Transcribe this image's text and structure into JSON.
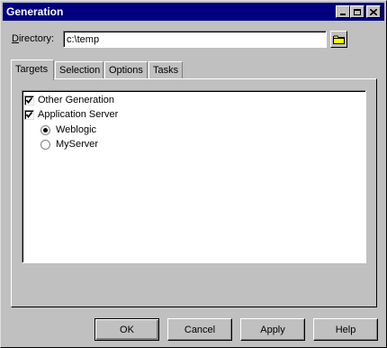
{
  "window": {
    "title": "Generation"
  },
  "directory": {
    "label_prefix": "D",
    "label_rest": "irectory:",
    "value": "c:\\temp"
  },
  "tabs": [
    {
      "label": "Targets",
      "active": true
    },
    {
      "label": "Selection",
      "active": false
    },
    {
      "label": "Options",
      "active": false
    },
    {
      "label": "Tasks",
      "active": false
    }
  ],
  "targets": {
    "items": [
      {
        "label": "Other Generation",
        "type": "checkbox",
        "checked": true
      },
      {
        "label": "Application Server",
        "type": "checkbox",
        "checked": true
      },
      {
        "label": "Weblogic",
        "type": "radio",
        "selected": true
      },
      {
        "label": "MyServer",
        "type": "radio",
        "selected": false
      }
    ]
  },
  "buttons": {
    "ok": "OK",
    "cancel": "Cancel",
    "apply": "Apply",
    "help": "Help"
  },
  "icons": {
    "minimize": "minimize-icon",
    "maximize": "maximize-icon",
    "close": "close-icon",
    "folder": "folder-icon",
    "folder_color": "#ffff00"
  }
}
